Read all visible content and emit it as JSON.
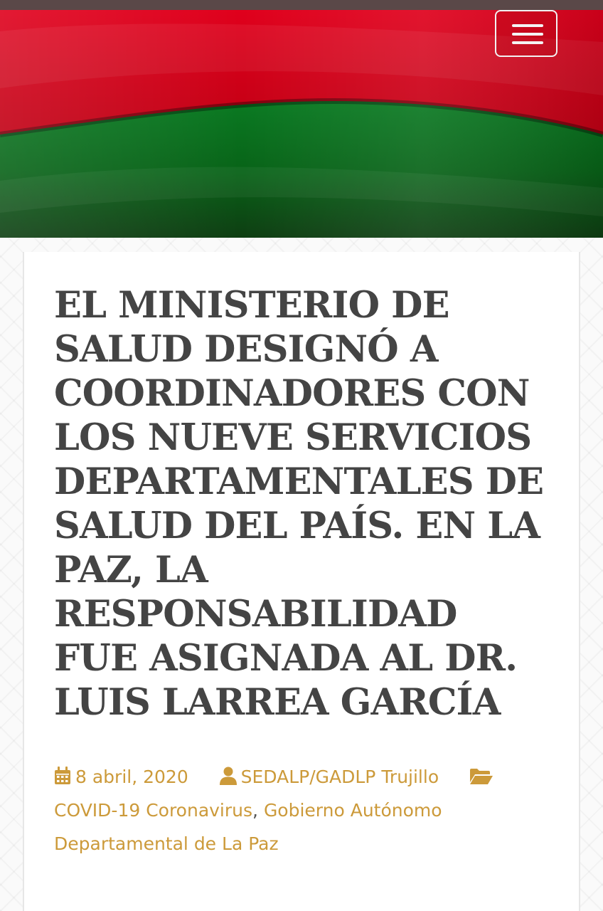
{
  "header": {
    "menu_icon": "hamburger-menu-icon",
    "colors": {
      "top_bar": "#5a4848",
      "flag_red": "#c8001a",
      "flag_green": "#0a6a1c"
    }
  },
  "post": {
    "title": "EL MINISTERIO DE SALUD DESIGNÓ A COORDINADORES CON LOS NUEVE SERVICIOS DEPARTAMENTALES DE SALUD DEL PAÍS. EN LA PAZ, LA RESPONSABILIDAD FUE ASIGNADA AL DR. LUIS LARREA GARCÍA",
    "date": "8 abril, 2020",
    "author": "SEDALP/GADLP Trujillo",
    "categories": [
      "COVID-19 Coronavirus",
      "Gobierno Autónomo Departamental de La Paz"
    ],
    "category_separator": ",",
    "icons": {
      "date": "calendar-icon",
      "author": "user-icon",
      "categories": "folder-open-icon"
    },
    "colors": {
      "title": "#444444",
      "meta_link": "#cc9a3a"
    }
  }
}
